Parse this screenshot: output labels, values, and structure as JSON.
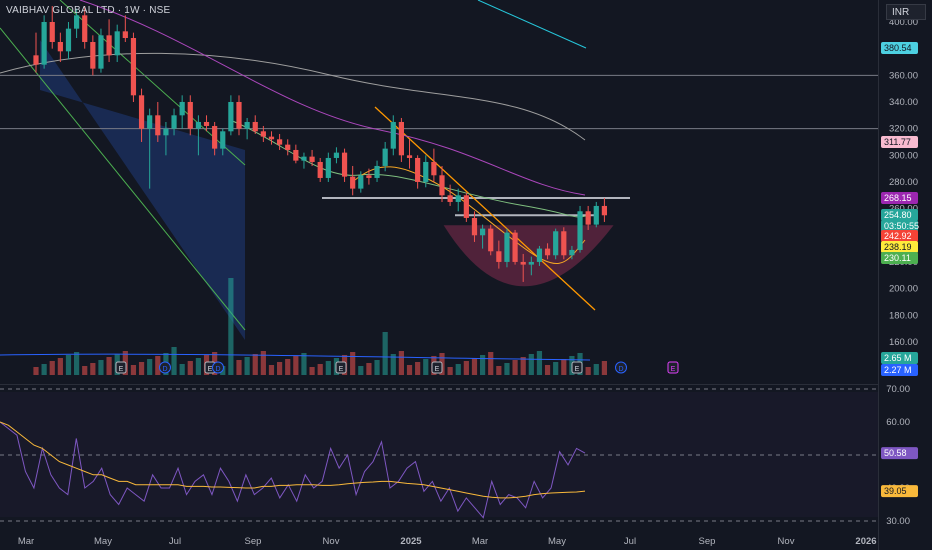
{
  "header": {
    "title": "VAIBHAV GLOBAL LTD · 1W · NSE",
    "currency": "INR"
  },
  "colors": {
    "background": "#131722",
    "up": "#26a69a",
    "down": "#ef5350",
    "rsi_line": "#7e57c2",
    "rsi_ma": "#f9b93b",
    "ma_gold": "#f5a623",
    "ma_green": "#7fbf7f",
    "ma_purple": "#ab47bc",
    "ma_grey": "#9e9e9e",
    "trend_orange": "#ff9800",
    "cup_pink": "#ec407a",
    "channel_green": "#4caf50",
    "channel_fill": "#1f3a7a"
  },
  "chart_data": {
    "type": "candlestick",
    "symbol": "VAIBHAV GLOBAL LTD",
    "interval": "1W",
    "exchange": "NSE",
    "price_axis_ticks": [
      400,
      380,
      360,
      340,
      320,
      300,
      280,
      260,
      240,
      220,
      200,
      180,
      160
    ],
    "x_axis_labels": [
      "Mar",
      "May",
      "Jul",
      "Sep",
      "Nov",
      "2025",
      "Mar",
      "May",
      "Jul",
      "Sep",
      "Nov",
      "2026"
    ],
    "price_labels": [
      {
        "value": "380.54",
        "color": "#4dd0e1"
      },
      {
        "value": "311.77",
        "color": "#f8bbd0"
      },
      {
        "value": "268.15",
        "color": "#9c27b0"
      },
      {
        "value": "254.80",
        "color": "#26a69a"
      },
      {
        "value": "03:50:55",
        "color": "#26a69a"
      },
      {
        "value": "242.92",
        "color": "#f44336"
      },
      {
        "value": "238.19",
        "color": "#ffeb3b"
      },
      {
        "value": "230.11",
        "color": "#4caf50"
      }
    ],
    "volume_labels": [
      {
        "value": "2.65 M",
        "color": "#26a69a"
      },
      {
        "value": "2.27 M",
        "color": "#2962ff"
      }
    ],
    "horizontal_lines": [
      360,
      320,
      268,
      255
    ],
    "candles": [
      {
        "o": 375,
        "h": 392,
        "l": 362,
        "c": 368
      },
      {
        "o": 368,
        "h": 405,
        "l": 365,
        "c": 400
      },
      {
        "o": 400,
        "h": 412,
        "l": 380,
        "c": 385
      },
      {
        "o": 385,
        "h": 392,
        "l": 370,
        "c": 378
      },
      {
        "o": 378,
        "h": 400,
        "l": 372,
        "c": 395
      },
      {
        "o": 395,
        "h": 410,
        "l": 388,
        "c": 405
      },
      {
        "o": 405,
        "h": 412,
        "l": 380,
        "c": 385
      },
      {
        "o": 385,
        "h": 390,
        "l": 360,
        "c": 365
      },
      {
        "o": 365,
        "h": 395,
        "l": 362,
        "c": 390
      },
      {
        "o": 390,
        "h": 402,
        "l": 370,
        "c": 375
      },
      {
        "o": 375,
        "h": 398,
        "l": 370,
        "c": 393
      },
      {
        "o": 393,
        "h": 405,
        "l": 385,
        "c": 388
      },
      {
        "o": 388,
        "h": 392,
        "l": 340,
        "c": 345
      },
      {
        "o": 345,
        "h": 350,
        "l": 310,
        "c": 320
      },
      {
        "o": 320,
        "h": 335,
        "l": 275,
        "c": 330
      },
      {
        "o": 330,
        "h": 340,
        "l": 310,
        "c": 315
      },
      {
        "o": 315,
        "h": 325,
        "l": 300,
        "c": 320
      },
      {
        "o": 320,
        "h": 335,
        "l": 315,
        "c": 330
      },
      {
        "o": 330,
        "h": 345,
        "l": 320,
        "c": 340
      },
      {
        "o": 340,
        "h": 345,
        "l": 315,
        "c": 320
      },
      {
        "o": 320,
        "h": 330,
        "l": 300,
        "c": 325
      },
      {
        "o": 325,
        "h": 330,
        "l": 318,
        "c": 322
      },
      {
        "o": 322,
        "h": 325,
        "l": 300,
        "c": 305
      },
      {
        "o": 305,
        "h": 320,
        "l": 300,
        "c": 318
      },
      {
        "o": 318,
        "h": 345,
        "l": 315,
        "c": 340
      },
      {
        "o": 340,
        "h": 345,
        "l": 315,
        "c": 320
      },
      {
        "o": 320,
        "h": 328,
        "l": 312,
        "c": 325
      },
      {
        "o": 325,
        "h": 330,
        "l": 316,
        "c": 318
      },
      {
        "o": 318,
        "h": 322,
        "l": 310,
        "c": 314
      },
      {
        "o": 314,
        "h": 318,
        "l": 308,
        "c": 312
      },
      {
        "o": 312,
        "h": 316,
        "l": 304,
        "c": 308
      },
      {
        "o": 308,
        "h": 312,
        "l": 300,
        "c": 304
      },
      {
        "o": 304,
        "h": 308,
        "l": 294,
        "c": 296
      },
      {
        "o": 296,
        "h": 302,
        "l": 290,
        "c": 299
      },
      {
        "o": 299,
        "h": 304,
        "l": 292,
        "c": 295
      },
      {
        "o": 295,
        "h": 298,
        "l": 280,
        "c": 283
      },
      {
        "o": 283,
        "h": 302,
        "l": 280,
        "c": 298
      },
      {
        "o": 298,
        "h": 306,
        "l": 294,
        "c": 302
      },
      {
        "o": 302,
        "h": 305,
        "l": 280,
        "c": 284
      },
      {
        "o": 284,
        "h": 292,
        "l": 270,
        "c": 275
      },
      {
        "o": 275,
        "h": 288,
        "l": 272,
        "c": 285
      },
      {
        "o": 285,
        "h": 290,
        "l": 278,
        "c": 283
      },
      {
        "o": 283,
        "h": 296,
        "l": 280,
        "c": 292
      },
      {
        "o": 292,
        "h": 310,
        "l": 288,
        "c": 305
      },
      {
        "o": 305,
        "h": 330,
        "l": 300,
        "c": 325
      },
      {
        "o": 325,
        "h": 328,
        "l": 295,
        "c": 300
      },
      {
        "o": 300,
        "h": 312,
        "l": 290,
        "c": 298
      },
      {
        "o": 298,
        "h": 300,
        "l": 275,
        "c": 280
      },
      {
        "o": 280,
        "h": 300,
        "l": 276,
        "c": 295
      },
      {
        "o": 295,
        "h": 305,
        "l": 280,
        "c": 285
      },
      {
        "o": 285,
        "h": 292,
        "l": 265,
        "c": 270
      },
      {
        "o": 270,
        "h": 278,
        "l": 262,
        "c": 265
      },
      {
        "o": 265,
        "h": 275,
        "l": 258,
        "c": 270
      },
      {
        "o": 270,
        "h": 272,
        "l": 250,
        "c": 253
      },
      {
        "o": 253,
        "h": 258,
        "l": 235,
        "c": 240
      },
      {
        "o": 240,
        "h": 248,
        "l": 230,
        "c": 245
      },
      {
        "o": 245,
        "h": 248,
        "l": 225,
        "c": 228
      },
      {
        "o": 228,
        "h": 236,
        "l": 215,
        "c": 220
      },
      {
        "o": 220,
        "h": 245,
        "l": 216,
        "c": 242
      },
      {
        "o": 242,
        "h": 244,
        "l": 218,
        "c": 220
      },
      {
        "o": 220,
        "h": 226,
        "l": 205,
        "c": 218
      },
      {
        "o": 218,
        "h": 224,
        "l": 210,
        "c": 220
      },
      {
        "o": 220,
        "h": 232,
        "l": 217,
        "c": 230
      },
      {
        "o": 230,
        "h": 234,
        "l": 222,
        "c": 225
      },
      {
        "o": 225,
        "h": 245,
        "l": 222,
        "c": 243
      },
      {
        "o": 243,
        "h": 246,
        "l": 222,
        "c": 225
      },
      {
        "o": 225,
        "h": 232,
        "l": 222,
        "c": 229
      },
      {
        "o": 229,
        "h": 262,
        "l": 227,
        "c": 258
      },
      {
        "o": 258,
        "h": 262,
        "l": 244,
        "c": 248
      },
      {
        "o": 248,
        "h": 265,
        "l": 246,
        "c": 262
      },
      {
        "o": 262,
        "h": 268,
        "l": 250,
        "c": 255
      }
    ],
    "rsi": {
      "axis_ticks": [
        70,
        60,
        50,
        40,
        30
      ],
      "current": "50.58",
      "ma_value": "39.05",
      "values": [
        60,
        58,
        56,
        45,
        40,
        52,
        44,
        40,
        38,
        55,
        40,
        42,
        46,
        38,
        35,
        40,
        38,
        36,
        44,
        40,
        40,
        46,
        38,
        42,
        44,
        38,
        46,
        42,
        36,
        44,
        38,
        40,
        43,
        37,
        41,
        36,
        44,
        40,
        42,
        52,
        46,
        50,
        38,
        45,
        48,
        54,
        40,
        42,
        46,
        48,
        39,
        42,
        36,
        40,
        33,
        37,
        34,
        31,
        42,
        35,
        38,
        37,
        34,
        42,
        37,
        40,
        51,
        47,
        52,
        50.58
      ],
      "ma_values": [
        60,
        59,
        57,
        55,
        53,
        52,
        50,
        48,
        47,
        46,
        45,
        44,
        44,
        43,
        42,
        42,
        41,
        41,
        41,
        41,
        41,
        41,
        40.5,
        40.5,
        40.5,
        40.3,
        40.3,
        40.2,
        40.1,
        40,
        40,
        40.5,
        40.5,
        40.8,
        40.8,
        41,
        41,
        41,
        40.8,
        40.8,
        41,
        41.3,
        41.5,
        41.7,
        41.8,
        42,
        42,
        41.7,
        41.4,
        41.2,
        41,
        40.5,
        40,
        39.5,
        39,
        38.5,
        38,
        37.5,
        37.2,
        37,
        37,
        37.2,
        37.5,
        38,
        38.3,
        38.5,
        38.6,
        38.7,
        38.8,
        39.05
      ]
    },
    "event_markers": [
      "E",
      "D",
      "E",
      "D",
      "E",
      "E",
      "E",
      "D",
      "E"
    ]
  }
}
